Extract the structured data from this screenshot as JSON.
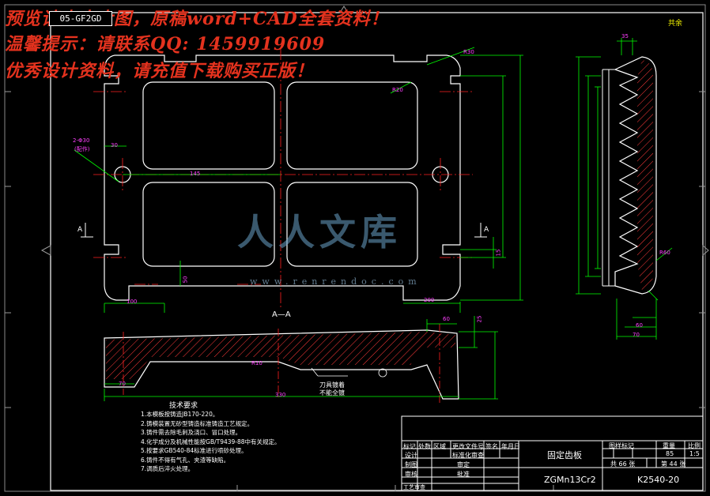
{
  "watermark": {
    "line1": "预览请点击大图，原稿word+CAD全套资料！",
    "line2": "温馨提示：请联系QQ: 1459919609",
    "line3": "优秀设计资料，请充值下载购买正版！"
  },
  "drawing_code": "05-GF2GD",
  "sheet_corner": "共余",
  "logo": {
    "text": "人人文库",
    "url": "www.renrendoc.com"
  },
  "section_label": "A—A",
  "view_marks": {
    "left": "A",
    "right": "A"
  },
  "dims": {
    "d_100": "100",
    "d_200": "200",
    "d_145": "145",
    "d_50": "50",
    "d_30": "30",
    "d_15": "15",
    "d_70": "70",
    "d_330": "330",
    "d_60": "60",
    "d_25": "25",
    "d_70r": "70",
    "d_60r": "60",
    "d_35": "35",
    "hole": "2-Φ30",
    "hole_sub": "(配作)",
    "r_top": "R30",
    "r_mid": "R20",
    "r_sec": "R10",
    "r_side": "R60"
  },
  "section_notes": {
    "note1": "刀具镀着",
    "note2": "不能全镀"
  },
  "tech_requirements": {
    "title": "技术要求",
    "items": [
      "1.本模板按铸造JB170-220。",
      "2.铸模装置无砂型铸造标准铸造工艺规定。",
      "3.铸件需去除毛刺及浇口、冒口处理。",
      "4.化学成分及机械性能按GB/T9439-88中有关规定。",
      "5.按要求GB540-84标准进行喷砂处理。",
      "6.铸件不得有气孔、夹渣等缺陷。",
      "7.调质后淬火处理。"
    ]
  },
  "title_block": {
    "headers": [
      "标记",
      "处数",
      "区域",
      "更改文件号",
      "签名",
      "年月日"
    ],
    "rows_left": [
      "设计",
      "制图",
      "审核",
      "工艺审查"
    ],
    "mid_labels": [
      "标准化审查",
      "审定",
      "批准"
    ],
    "part_name": "固定齿板",
    "material": "ZGMn13Cr2",
    "stage_label": "图样标记",
    "weight_label": "重量",
    "scale_label": "比例",
    "weight_value": "85",
    "scale_value": "1:5",
    "sheets_total": "共 66 张",
    "sheet_no": "第 44 张",
    "drawing_no": "K2540-20"
  },
  "colors": {
    "outline": "#ffffff",
    "dimension": "#00ff00",
    "center_line": "#ff2020",
    "magenta_text": "#ff40ff",
    "hatch": "#ff3a3a",
    "watermark": "#e4321e",
    "title_text_highlight": "#ffff00"
  }
}
